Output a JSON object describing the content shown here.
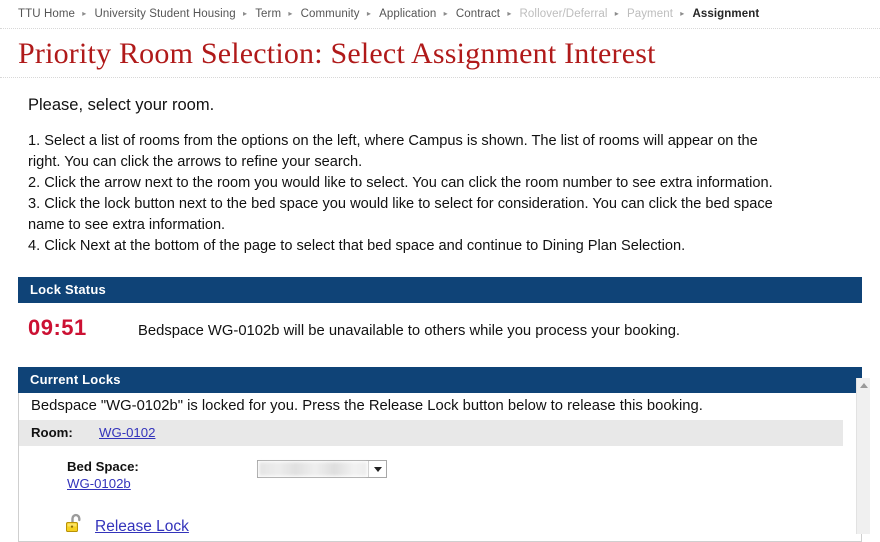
{
  "breadcrumb": {
    "separator": "▸",
    "items": [
      {
        "label": "TTU Home",
        "state": "link"
      },
      {
        "label": "University Student Housing",
        "state": "link"
      },
      {
        "label": "Term",
        "state": "link"
      },
      {
        "label": "Community",
        "state": "link"
      },
      {
        "label": "Application",
        "state": "link"
      },
      {
        "label": "Contract",
        "state": "link"
      },
      {
        "label": "Rollover/Deferral",
        "state": "disabled"
      },
      {
        "label": "Payment",
        "state": "disabled"
      },
      {
        "label": "Assignment",
        "state": "current"
      }
    ]
  },
  "page": {
    "title": "Priority Room Selection: Select Assignment Interest",
    "lead": "Please, select your room.",
    "steps": [
      "1. Select a list of rooms from the options on the left, where Campus is shown.  The list of rooms will appear on the",
      "right.  You can click the arrows to refine your search.",
      "2. Click the arrow next to the room you would like to select.  You can click the room number to see extra information.",
      "3. Click the lock button next to the bed space you would like to select for consideration.  You can click the bed space",
      "name to see extra information.",
      "4. Click Next at the bottom of the page to select that bed space and continue to Dining Plan Selection."
    ]
  },
  "lock_status": {
    "header": "Lock Status",
    "timer": "09:51",
    "message": "Bedspace WG-0102b will be unavailable to others while you process your booking."
  },
  "current_locks": {
    "header": "Current Locks",
    "intro": "Bedspace \"WG-0102b\" is locked for you. Press the Release Lock button below to release this booking.",
    "room_label": "Room:",
    "room_value": "WG-0102",
    "bedspace_label": "Bed Space:",
    "bedspace_value": "WG-0102b",
    "bedspace_select_value": "",
    "release_label": "Release Lock"
  },
  "colors": {
    "panel_header": "#0f4377",
    "title_red": "#b01a1a",
    "timer_red": "#cc1133",
    "link_blue": "#3333bb",
    "row_gray": "#e8e8e8"
  }
}
